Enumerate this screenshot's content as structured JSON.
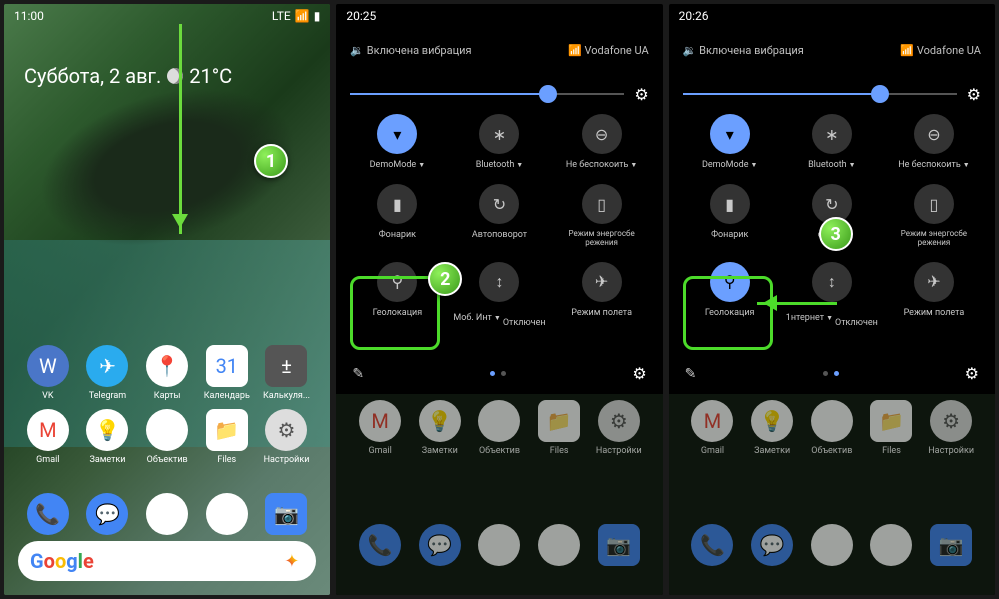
{
  "p1": {
    "time": "11:00",
    "net": "LTE",
    "date": "Суббота, 2 авг.",
    "temp": "21°C",
    "apps": [
      {
        "n": "VK",
        "c": "vk",
        "i": "W"
      },
      {
        "n": "Telegram",
        "c": "tg",
        "i": "✈"
      },
      {
        "n": "Карты",
        "c": "maps",
        "i": "📍"
      },
      {
        "n": "Календарь",
        "c": "cal",
        "i": "31"
      },
      {
        "n": "Калькуля...",
        "c": "calc",
        "i": "±"
      },
      {
        "n": "Gmail",
        "c": "gmail",
        "i": "M"
      },
      {
        "n": "Заметки",
        "c": "keep",
        "i": "💡"
      },
      {
        "n": "Объектив",
        "c": "lens",
        "i": "◎"
      },
      {
        "n": "Files",
        "c": "files",
        "i": "📁"
      },
      {
        "n": "Настройки",
        "c": "sett",
        "i": "⚙"
      }
    ],
    "dock": [
      {
        "c": "phone",
        "i": "📞"
      },
      {
        "c": "msg",
        "i": "💬"
      },
      {
        "c": "play",
        "i": "▶"
      },
      {
        "c": "chrome",
        "i": "◉"
      },
      {
        "c": "cam",
        "i": "📷"
      }
    ],
    "badge": "1"
  },
  "p2": {
    "time": "20:25",
    "vib": "Включена вибрация",
    "car": "Vodafone UA",
    "bright": 72,
    "tiles": [
      {
        "i": "▾",
        "l": "DemoMode",
        "on": true,
        "d": true
      },
      {
        "i": "∗",
        "l": "Bluetooth",
        "d": true
      },
      {
        "i": "⊖",
        "l": "Не беспокоить",
        "d": true
      },
      {
        "i": "▮",
        "l": "Фонарик"
      },
      {
        "i": "↻",
        "l": "Автоповорот"
      },
      {
        "i": "▯",
        "l": "Режим энергосбе режения",
        "sm": true
      },
      {
        "i": "⚲",
        "l": "Геолокация"
      },
      {
        "i": "↕",
        "l": "Моб. Инт",
        "s": "Отключен",
        "d": true
      },
      {
        "i": "✈",
        "l": "Режим полета"
      }
    ],
    "badge": "2",
    "dim_apps": [
      "Gmail",
      "Заметки",
      "Объектив",
      "Files",
      "Настройки"
    ]
  },
  "p3": {
    "time": "20:26",
    "vib": "Включена вибрация",
    "car": "Vodafone UA",
    "bright": 72,
    "tiles": [
      {
        "i": "▾",
        "l": "DemoMode",
        "on": true,
        "d": true
      },
      {
        "i": "∗",
        "l": "Bluetooth",
        "d": true
      },
      {
        "i": "⊖",
        "l": "Не беспокоить",
        "d": true
      },
      {
        "i": "▮",
        "l": "Фонарик"
      },
      {
        "i": "↻",
        "l": "орот",
        "d": true
      },
      {
        "i": "▯",
        "l": "Режим энергосбе режения",
        "sm": true
      },
      {
        "i": "⚲",
        "l": "Геолокация",
        "on": true
      },
      {
        "i": "↕",
        "l": "1нтернет",
        "s": "Отключен",
        "d": true
      },
      {
        "i": "✈",
        "l": "Режим полета"
      }
    ],
    "badge": "3",
    "dim_apps": [
      "Gmail",
      "Заметки",
      "Объектив",
      "Files",
      "Настройки"
    ]
  }
}
